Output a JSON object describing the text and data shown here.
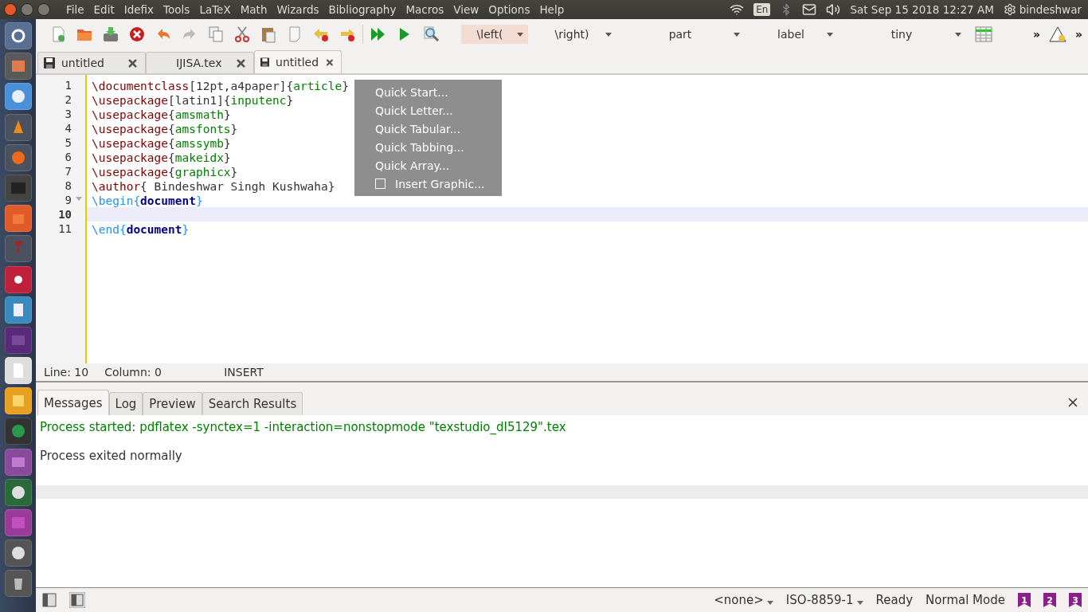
{
  "top_panel": {
    "menu": [
      "File",
      "Edit",
      "Idefix",
      "Tools",
      "LaTeX",
      "Math",
      "Wizards",
      "Bibliography",
      "Macros",
      "View",
      "Options",
      "Help"
    ],
    "keyboard": "En",
    "clock": "Sat Sep 15 2018 12:27 AM",
    "user": "bindeshwar"
  },
  "toolbar": {
    "combos": [
      {
        "value": "\\left(",
        "highlighted": true
      },
      {
        "value": "\\right)",
        "highlighted": false
      },
      {
        "value": "part",
        "highlighted": false
      },
      {
        "value": "label",
        "highlighted": false
      },
      {
        "value": "tiny",
        "highlighted": false
      }
    ],
    "overflow": [
      "»",
      "»"
    ]
  },
  "tabs": [
    {
      "label": "untitled",
      "unsaved": true,
      "selected": false
    },
    {
      "label": "IJISA.tex",
      "unsaved": false,
      "selected": false
    },
    {
      "label": "untitled",
      "unsaved": true,
      "selected": true
    }
  ],
  "editor": {
    "lines": [
      {
        "number": "1",
        "current": false,
        "foldable": false,
        "tokens": [
          {
            "kind": "cmd",
            "text": "\\documentclass"
          },
          {
            "kind": "plain",
            "text": "[12pt,a4paper]{"
          },
          {
            "kind": "arg",
            "text": "article"
          },
          {
            "kind": "plain",
            "text": "}"
          }
        ]
      },
      {
        "number": "2",
        "current": false,
        "foldable": false,
        "tokens": [
          {
            "kind": "cmd",
            "text": "\\usepackage"
          },
          {
            "kind": "plain",
            "text": "[latin1]{"
          },
          {
            "kind": "arg",
            "text": "inputenc"
          },
          {
            "kind": "plain",
            "text": "}"
          }
        ]
      },
      {
        "number": "3",
        "current": false,
        "foldable": false,
        "tokens": [
          {
            "kind": "cmd",
            "text": "\\usepackage"
          },
          {
            "kind": "plain",
            "text": "{"
          },
          {
            "kind": "arg",
            "text": "amsmath"
          },
          {
            "kind": "plain",
            "text": "}"
          }
        ]
      },
      {
        "number": "4",
        "current": false,
        "foldable": false,
        "tokens": [
          {
            "kind": "cmd",
            "text": "\\usepackage"
          },
          {
            "kind": "plain",
            "text": "{"
          },
          {
            "kind": "arg",
            "text": "amsfonts"
          },
          {
            "kind": "plain",
            "text": "}"
          }
        ]
      },
      {
        "number": "5",
        "current": false,
        "foldable": false,
        "tokens": [
          {
            "kind": "cmd",
            "text": "\\usepackage"
          },
          {
            "kind": "plain",
            "text": "{"
          },
          {
            "kind": "arg",
            "text": "amssymb"
          },
          {
            "kind": "plain",
            "text": "}"
          }
        ]
      },
      {
        "number": "6",
        "current": false,
        "foldable": false,
        "tokens": [
          {
            "kind": "cmd",
            "text": "\\usepackage"
          },
          {
            "kind": "plain",
            "text": "{"
          },
          {
            "kind": "arg",
            "text": "makeidx"
          },
          {
            "kind": "plain",
            "text": "}"
          }
        ]
      },
      {
        "number": "7",
        "current": false,
        "foldable": false,
        "tokens": [
          {
            "kind": "cmd",
            "text": "\\usepackage"
          },
          {
            "kind": "plain",
            "text": "{"
          },
          {
            "kind": "arg",
            "text": "graphicx"
          },
          {
            "kind": "plain",
            "text": "}"
          }
        ]
      },
      {
        "number": "8",
        "current": false,
        "foldable": false,
        "tokens": [
          {
            "kind": "cmd",
            "text": "\\author"
          },
          {
            "kind": "plain",
            "text": "{ Bindeshwar Singh Kushwaha}"
          }
        ]
      },
      {
        "number": "9",
        "current": false,
        "foldable": true,
        "tokens": [
          {
            "kind": "env",
            "text": "\\begin{"
          },
          {
            "kind": "envname",
            "text": "document"
          },
          {
            "kind": "env",
            "text": "}"
          }
        ]
      },
      {
        "number": "10",
        "current": true,
        "foldable": false
      },
      {
        "number": "11",
        "current": false,
        "foldable": false,
        "tokens": [
          {
            "kind": "env",
            "text": "\\end{"
          },
          {
            "kind": "envname",
            "text": "document"
          },
          {
            "kind": "env",
            "text": "}"
          }
        ]
      }
    ]
  },
  "editor_status": {
    "line": "Line: 10",
    "column": "Column: 0",
    "mode": "INSERT"
  },
  "popup_menu": {
    "items": [
      {
        "label": "Quick Start...",
        "checkbox": false
      },
      {
        "label": "Quick Letter...",
        "checkbox": false
      },
      {
        "label": "Quick Tabular...",
        "checkbox": false
      },
      {
        "label": "Quick Tabbing...",
        "checkbox": false
      },
      {
        "label": "Quick Array...",
        "checkbox": false
      },
      {
        "label": "Insert Graphic...",
        "checkbox": true
      }
    ]
  },
  "messages_panel": {
    "tabs": [
      {
        "label": "Messages",
        "selected": true
      },
      {
        "label": "Log",
        "selected": false
      },
      {
        "label": "Preview",
        "selected": false
      },
      {
        "label": "Search Results",
        "selected": false
      }
    ],
    "lines": [
      {
        "kind": "info",
        "text": "Process started: pdflatex -synctex=1 -interaction=nonstopmode \"texstudio_dI5129\".tex"
      },
      {
        "kind": "plain",
        "text": "Process exited normally"
      }
    ]
  },
  "status_bar": {
    "combos": [
      "<none>",
      "ISO-8859-1"
    ],
    "state": "Ready",
    "mode": "Normal Mode",
    "bookmarks": [
      "1",
      "2",
      "3"
    ]
  }
}
